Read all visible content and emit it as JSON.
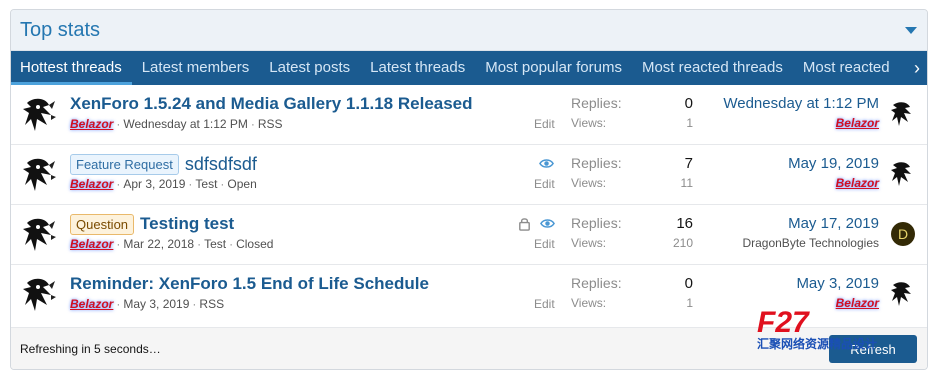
{
  "header": {
    "title": "Top stats"
  },
  "tabs": [
    {
      "label": "Hottest threads",
      "active": true
    },
    {
      "label": "Latest members"
    },
    {
      "label": "Latest posts"
    },
    {
      "label": "Latest threads"
    },
    {
      "label": "Most popular forums"
    },
    {
      "label": "Most reacted threads"
    },
    {
      "label": "Most reacted"
    }
  ],
  "threads": [
    {
      "title": "XenForo 1.5.24 and Media Gallery 1.1.18 Released",
      "prefix": "",
      "author": "Belazor",
      "date": "Wednesday at 1:12 PM",
      "forum": "RSS",
      "status": "",
      "edit": "Edit",
      "replies_label": "Replies:",
      "replies": "0",
      "views_label": "Views:",
      "views": "1",
      "last_date": "Wednesday at 1:12 PM",
      "last_user": "Belazor"
    },
    {
      "title": "sdfsdfsdf",
      "prefix": "Feature Request",
      "author": "Belazor",
      "date": "Apr 3, 2019",
      "forum": "Test",
      "status": "Open",
      "edit": "Edit",
      "replies_label": "Replies:",
      "replies": "7",
      "views_label": "Views:",
      "views": "11",
      "last_date": "May 19, 2019",
      "last_user": "Belazor"
    },
    {
      "title": "Testing test",
      "prefix": "Question",
      "author": "Belazor",
      "date": "Mar 22, 2018",
      "forum": "Test",
      "status": "Closed",
      "edit": "Edit",
      "replies_label": "Replies:",
      "replies": "16",
      "views_label": "Views:",
      "views": "210",
      "last_date": "May 17, 2019",
      "last_user": "DragonByte Technologies",
      "last_avatar_letter": "D"
    },
    {
      "title": "Reminder: XenForo 1.5 End of Life Schedule",
      "prefix": "",
      "author": "Belazor",
      "date": "May 3, 2019",
      "forum": "RSS",
      "status": "",
      "edit": "Edit",
      "replies_label": "Replies:",
      "replies": "0",
      "views_label": "Views:",
      "views": "1",
      "last_date": "May 3, 2019",
      "last_user": "Belazor"
    }
  ],
  "footer": {
    "status": "Refreshing in 5 seconds…",
    "refresh_label": "Refresh"
  },
  "watermark": {
    "text": "F27",
    "subtext": "汇聚网络资源精品设计"
  },
  "colors": {
    "accent": "#1b5b90",
    "link": "#2577b1",
    "username": "#d10f23"
  }
}
